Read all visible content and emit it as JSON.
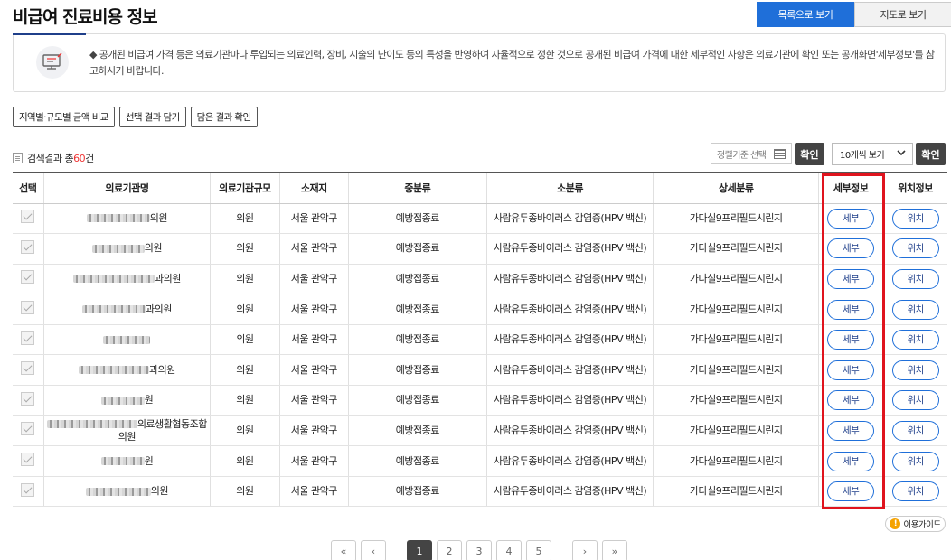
{
  "page": {
    "title": "비급여 진료비용 정보"
  },
  "view_toggle": {
    "list": "목록으로 보기",
    "map": "지도로 보기"
  },
  "notice": {
    "text": "◆ 공개된 비급여 가격 등은 의료기관마다 투입되는 의료인력, 장비, 시술의 난이도 등의 특성을 반영하여 자율적으로 정한 것으로 공개된 비급여 가격에 대한 세부적인 사항은 의료기관에 확인 또는 공개화면'세부정보'를 참고하시기 바랍니다.",
    "icon": "monitor-icon"
  },
  "actions": {
    "compare": "지역별·규모별 금액 비교",
    "save_selection": "선택 결과 담기",
    "check_saved": "담은 결과 확인"
  },
  "results": {
    "prefix": "검색결과 총",
    "count": "60",
    "suffix": "건"
  },
  "sort": {
    "placeholder": "정렬기준 선택",
    "confirm": "확인"
  },
  "perpage": {
    "value": "10개씩 보기",
    "confirm": "확인"
  },
  "table": {
    "headers": [
      "선택",
      "의료기관명",
      "의료기관규모",
      "소재지",
      "중분류",
      "소분류",
      "상세분류",
      "세부정보",
      "위치정보"
    ],
    "rows": [
      {
        "name_tail": "의원",
        "size": "의원",
        "location": "서울 관악구",
        "mid": "예방접종료",
        "small": "사람유두종바이러스 감염증(HPV 백신)",
        "detail": "가다실9프리필드시린지",
        "info_btn": "세부",
        "loc_btn": "위치"
      },
      {
        "name_tail": "의원",
        "size": "의원",
        "location": "서울 관악구",
        "mid": "예방접종료",
        "small": "사람유두종바이러스 감염증(HPV 백신)",
        "detail": "가다실9프리필드시린지",
        "info_btn": "세부",
        "loc_btn": "위치"
      },
      {
        "name_tail": "과의원",
        "size": "의원",
        "location": "서울 관악구",
        "mid": "예방접종료",
        "small": "사람유두종바이러스 감염증(HPV 백신)",
        "detail": "가다실9프리필드시린지",
        "info_btn": "세부",
        "loc_btn": "위치"
      },
      {
        "name_tail": "과의원",
        "size": "의원",
        "location": "서울 관악구",
        "mid": "예방접종료",
        "small": "사람유두종바이러스 감염증(HPV 백신)",
        "detail": "가다실9프리필드시린지",
        "info_btn": "세부",
        "loc_btn": "위치"
      },
      {
        "name_tail": "",
        "size": "의원",
        "location": "서울 관악구",
        "mid": "예방접종료",
        "small": "사람유두종바이러스 감염증(HPV 백신)",
        "detail": "가다실9프리필드시린지",
        "info_btn": "세부",
        "loc_btn": "위치"
      },
      {
        "name_tail": "과의원",
        "size": "의원",
        "location": "서울 관악구",
        "mid": "예방접종료",
        "small": "사람유두종바이러스 감염증(HPV 백신)",
        "detail": "가다실9프리필드시린지",
        "info_btn": "세부",
        "loc_btn": "위치"
      },
      {
        "name_tail": "원",
        "size": "의원",
        "location": "서울 관악구",
        "mid": "예방접종료",
        "small": "사람유두종바이러스 감염증(HPV 백신)",
        "detail": "가다실9프리필드시린지",
        "info_btn": "세부",
        "loc_btn": "위치"
      },
      {
        "name_tail": "의료생활협동조합의원",
        "size": "의원",
        "location": "서울 관악구",
        "mid": "예방접종료",
        "small": "사람유두종바이러스 감염증(HPV 백신)",
        "detail": "가다실9프리필드시린지",
        "info_btn": "세부",
        "loc_btn": "위치"
      },
      {
        "name_tail": "원",
        "size": "의원",
        "location": "서울 관악구",
        "mid": "예방접종료",
        "small": "사람유두종바이러스 감염증(HPV 백신)",
        "detail": "가다실9프리필드시린지",
        "info_btn": "세부",
        "loc_btn": "위치"
      },
      {
        "name_tail": "의원",
        "size": "의원",
        "location": "서울 관악구",
        "mid": "예방접종료",
        "small": "사람유두종바이러스 감염증(HPV 백신)",
        "detail": "가다실9프리필드시린지",
        "info_btn": "세부",
        "loc_btn": "위치"
      }
    ]
  },
  "guide": {
    "label": "이용가이드",
    "icon": "exclamation-icon"
  },
  "pagination": {
    "first": "«",
    "prev": "‹",
    "pages": [
      "1",
      "2",
      "3",
      "4",
      "5"
    ],
    "current": "1",
    "next": "›",
    "last": "»"
  },
  "colors": {
    "primary": "#1f6fd9",
    "highlight_box": "#e0141e",
    "count": "#e33333"
  }
}
